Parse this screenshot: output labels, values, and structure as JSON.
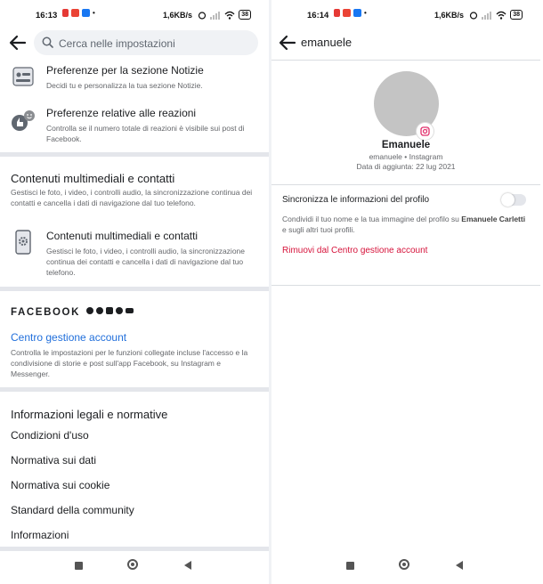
{
  "left_phone": {
    "status": {
      "time": "16:13",
      "speed": "1,6KB/s",
      "battery": "38"
    },
    "search": {
      "placeholder": "Cerca nelle impostazioni"
    },
    "news_pref": {
      "title": "Preferenze per la sezione Notizie",
      "desc": "Decidi tu e personalizza la tua sezione Notizie."
    },
    "reactions_pref": {
      "title": "Preferenze relative alle reazioni",
      "desc": "Controlla se il numero totale di reazioni è visibile sui post di Facebook."
    },
    "media_section": {
      "title": "Contenuti multimediali e contatti",
      "desc": "Gestisci le foto, i video, i controlli audio, la sincronizzazione continua dei contatti e cancella i dati di navigazione dal tuo telefono.",
      "item_title": "Contenuti multimediali e contatti",
      "item_desc": "Gestisci le foto, i video, i controlli audio, la sincronizzazione continua dei contatti e cancella i dati di navigazione dal tuo telefono."
    },
    "facebook": {
      "brand": "FACEBOOK",
      "link": "Centro gestione account",
      "desc": "Controlla le impostazioni per le funzioni collegate incluse l'accesso e la condivisione di storie e post sull'app Facebook, su Instagram e Messenger."
    },
    "legal": {
      "title": "Informazioni legali e normative",
      "items": [
        "Condizioni d'uso",
        "Normativa sui dati",
        "Normativa sui cookie",
        "Standard della community",
        "Informazioni"
      ]
    }
  },
  "right_phone": {
    "status": {
      "time": "16:14",
      "speed": "1,6KB/s",
      "battery": "38"
    },
    "title": "emanuele",
    "profile": {
      "name": "Emanuele",
      "source": "emanuele • Instagram",
      "date_added": "Data di aggiunta: 22 lug 2021"
    },
    "sync": {
      "title": "Sincronizza le informazioni del profilo",
      "desc_pre": "Condividi il tuo nome e la tua immagine del profilo su ",
      "desc_name": "Emanuele Carletti",
      "desc_post": " e sugli altri tuoi profili.",
      "enabled": false
    },
    "remove_link": "Rimuovi dal Centro gestione account"
  },
  "colors": {
    "link_blue": "#216fdb",
    "danger_red": "#d6133b",
    "divider_gray": "#e4e6eb"
  }
}
